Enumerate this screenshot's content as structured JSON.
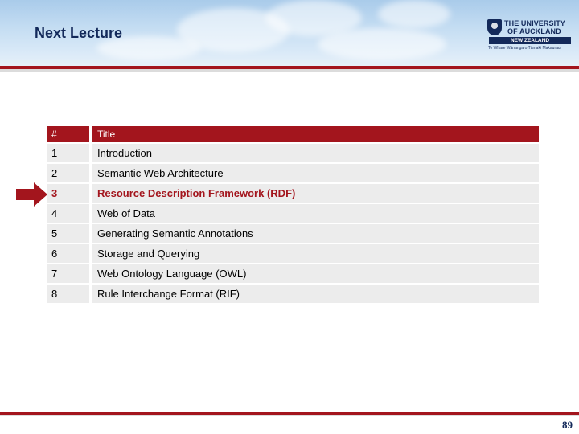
{
  "slide": {
    "title": "Next Lecture",
    "page_number": "89"
  },
  "logo": {
    "line1": "THE UNIVERSITY",
    "line2": "OF AUCKLAND",
    "country": "NEW ZEALAND",
    "tagline": "Te Whare Wānanga o Tāmaki Makaurau"
  },
  "table": {
    "headers": [
      "#",
      "Title"
    ],
    "current_row_index": 2,
    "rows": [
      {
        "num": "1",
        "title": "Introduction"
      },
      {
        "num": "2",
        "title": "Semantic Web Architecture"
      },
      {
        "num": "3",
        "title": "Resource Description Framework (RDF)"
      },
      {
        "num": "4",
        "title": "Web of Data"
      },
      {
        "num": "5",
        "title": "Generating Semantic Annotations"
      },
      {
        "num": "6",
        "title": "Storage and Querying"
      },
      {
        "num": "7",
        "title": "Web Ontology Language (OWL)"
      },
      {
        "num": "8",
        "title": "Rule Interchange Format (RIF)"
      }
    ]
  },
  "colors": {
    "accent": "#a3151d",
    "navy": "#13295a",
    "row_background": "#ececec"
  }
}
